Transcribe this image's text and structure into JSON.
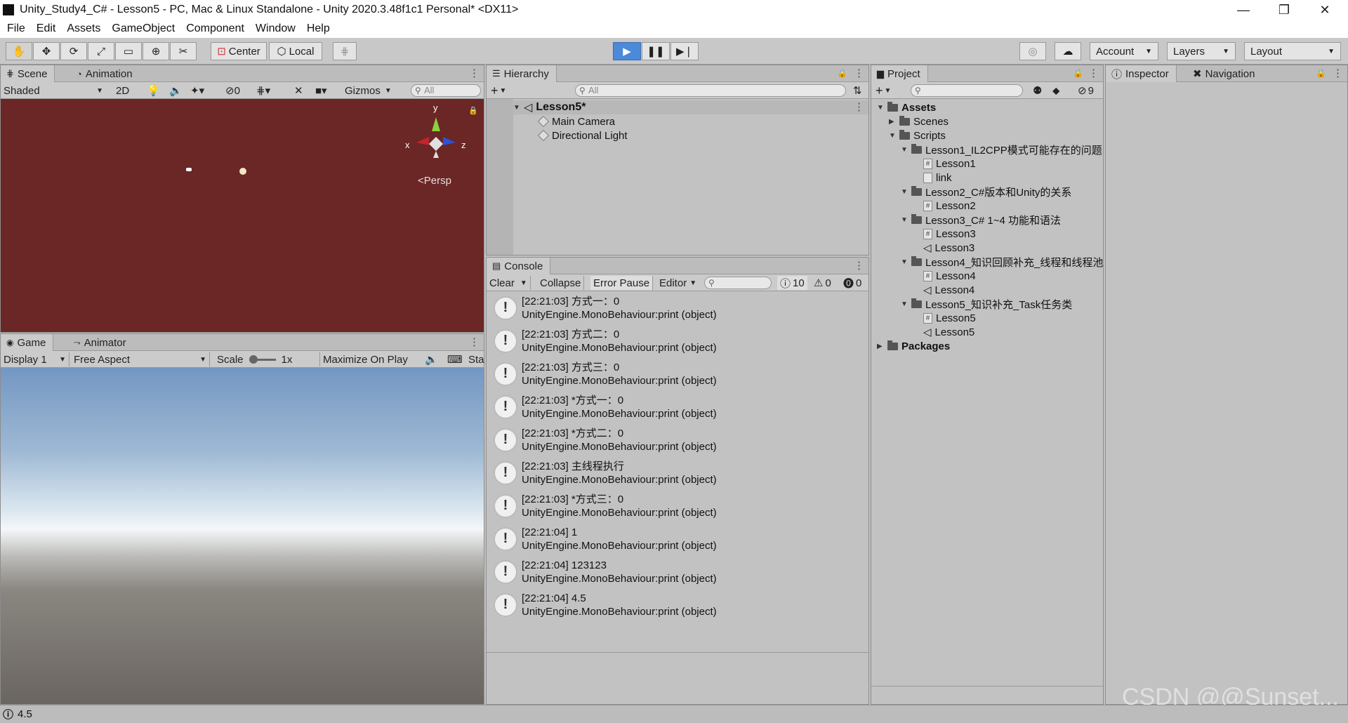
{
  "window": {
    "title": "Unity_Study4_C# - Lesson5 - PC, Mac & Linux Standalone - Unity 2020.3.48f1c1 Personal* <DX11>"
  },
  "menu": [
    "File",
    "Edit",
    "Assets",
    "GameObject",
    "Component",
    "Window",
    "Help"
  ],
  "toolbar": {
    "center": "Center",
    "local": "Local",
    "account": "Account",
    "layers": "Layers",
    "layout": "Layout"
  },
  "scene": {
    "tab": "Scene",
    "tab2": "Animation",
    "shading": "Shaded",
    "mode2d": "2D",
    "hidden_count": "0",
    "gizmos": "Gizmos",
    "search": "All",
    "persp": "Persp",
    "axis_y": "y",
    "axis_x": "x",
    "axis_z": "z"
  },
  "game": {
    "tab": "Game",
    "tab2": "Animator",
    "display": "Display 1",
    "aspect": "Free Aspect",
    "scale_label": "Scale",
    "scale_value": "1x",
    "maximize": "Maximize On Play",
    "stats": "Sta"
  },
  "hierarchy": {
    "tab": "Hierarchy",
    "search": "All",
    "scene": "Lesson5*",
    "items": [
      "Main Camera",
      "Directional Light"
    ]
  },
  "console": {
    "tab": "Console",
    "clear": "Clear",
    "collapse": "Collapse",
    "error_pause": "Error Pause",
    "editor": "Editor",
    "count_log": "10",
    "count_warn": "0",
    "count_err": "0",
    "entries": [
      {
        "line1": "[22:21:03] 方式一：0",
        "line2": "UnityEngine.MonoBehaviour:print (object)"
      },
      {
        "line1": "[22:21:03] 方式二：0",
        "line2": "UnityEngine.MonoBehaviour:print (object)"
      },
      {
        "line1": "[22:21:03] 方式三：0",
        "line2": "UnityEngine.MonoBehaviour:print (object)"
      },
      {
        "line1": "[22:21:03] *方式一：0",
        "line2": "UnityEngine.MonoBehaviour:print (object)"
      },
      {
        "line1": "[22:21:03] *方式二：0",
        "line2": "UnityEngine.MonoBehaviour:print (object)"
      },
      {
        "line1": "[22:21:03] 主线程执行",
        "line2": "UnityEngine.MonoBehaviour:print (object)"
      },
      {
        "line1": "[22:21:03] *方式三：0",
        "line2": "UnityEngine.MonoBehaviour:print (object)"
      },
      {
        "line1": "[22:21:04] 1",
        "line2": "UnityEngine.MonoBehaviour:print (object)"
      },
      {
        "line1": "[22:21:04] 123123",
        "line2": "UnityEngine.MonoBehaviour:print (object)"
      },
      {
        "line1": "[22:21:04] 4.5",
        "line2": "UnityEngine.MonoBehaviour:print (object)"
      }
    ]
  },
  "project": {
    "tab": "Project",
    "hidden_count": "9",
    "tree": [
      {
        "label": "Assets",
        "kind": "folder",
        "indent": 0,
        "open": true,
        "bold": true
      },
      {
        "label": "Scenes",
        "kind": "folder",
        "indent": 1,
        "open": false
      },
      {
        "label": "Scripts",
        "kind": "folder",
        "indent": 1,
        "open": true
      },
      {
        "label": "Lesson1_IL2CPP模式可能存在的问题",
        "kind": "folder",
        "indent": 2,
        "open": true
      },
      {
        "label": "Lesson1",
        "kind": "script",
        "indent": 3
      },
      {
        "label": "link",
        "kind": "file",
        "indent": 3
      },
      {
        "label": "Lesson2_C#版本和Unity的关系",
        "kind": "folder",
        "indent": 2,
        "open": true
      },
      {
        "label": "Lesson2",
        "kind": "script",
        "indent": 3
      },
      {
        "label": "Lesson3_C# 1~4 功能和语法",
        "kind": "folder",
        "indent": 2,
        "open": true
      },
      {
        "label": "Lesson3",
        "kind": "script",
        "indent": 3
      },
      {
        "label": "Lesson3",
        "kind": "scene",
        "indent": 3
      },
      {
        "label": "Lesson4_知识回顾补充_线程和线程池",
        "kind": "folder",
        "indent": 2,
        "open": true
      },
      {
        "label": "Lesson4",
        "kind": "script",
        "indent": 3
      },
      {
        "label": "Lesson4",
        "kind": "scene",
        "indent": 3
      },
      {
        "label": "Lesson5_知识补充_Task任务类",
        "kind": "folder",
        "indent": 2,
        "open": true
      },
      {
        "label": "Lesson5",
        "kind": "script",
        "indent": 3
      },
      {
        "label": "Lesson5",
        "kind": "scene",
        "indent": 3
      },
      {
        "label": "Packages",
        "kind": "folder",
        "indent": 0,
        "open": false,
        "bold": true
      }
    ]
  },
  "inspector": {
    "tab": "Inspector",
    "tab2": "Navigation"
  },
  "status": {
    "message": "4.5"
  },
  "watermark": "CSDN @@Sunset..."
}
